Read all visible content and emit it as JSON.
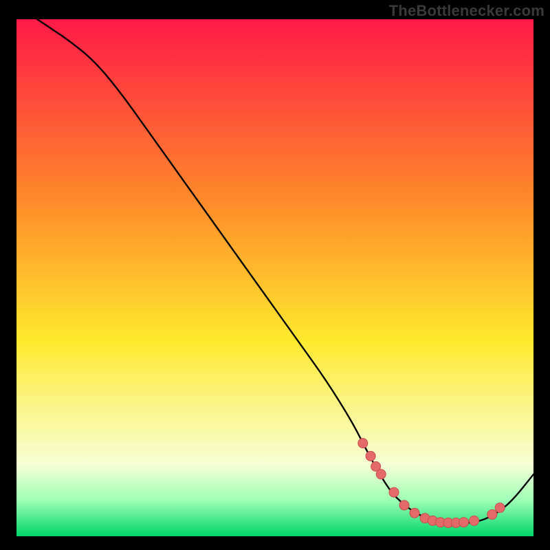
{
  "watermark": "TheBottlenecker.com",
  "colors": {
    "frame": "#000000",
    "curve": "#000000",
    "marker_fill": "#e46a6a",
    "marker_stroke": "#c94b4b",
    "grad_top": "#ff1a47",
    "grad_mid_upper": "#ff8a2a",
    "grad_mid": "#ffe92e",
    "grad_low": "#f7ffd6",
    "grad_green_top": "#9fffb7",
    "grad_green_bottom": "#00d46a"
  },
  "chart_data": {
    "type": "line",
    "title": "",
    "xlabel": "",
    "ylabel": "",
    "xlim": [
      0,
      100
    ],
    "ylim": [
      0,
      100
    ],
    "grid": false,
    "legend": false,
    "series": [
      {
        "name": "bottleneck-curve",
        "x": [
          4,
          7,
          10,
          15,
          20,
          25,
          30,
          35,
          40,
          45,
          50,
          55,
          60,
          65,
          68,
          72,
          75,
          78,
          81,
          84,
          87,
          90,
          93,
          96,
          100
        ],
        "y": [
          100,
          98,
          96,
          92,
          86,
          79,
          72,
          65,
          58,
          51,
          44,
          37,
          30,
          22,
          16,
          9,
          6,
          4,
          3,
          2.5,
          2.5,
          3,
          4.5,
          7,
          12
        ]
      }
    ],
    "markers": {
      "name": "highlight-points",
      "x": [
        67,
        68.5,
        69.5,
        70.5,
        73,
        75,
        77,
        79,
        80.5,
        82,
        83.5,
        85,
        86.5,
        88.5,
        92,
        93.5
      ],
      "y": [
        18,
        15.5,
        13.5,
        12,
        8.5,
        6,
        4.5,
        3.5,
        3,
        2.7,
        2.6,
        2.6,
        2.7,
        3,
        4.2,
        5.5
      ]
    }
  }
}
